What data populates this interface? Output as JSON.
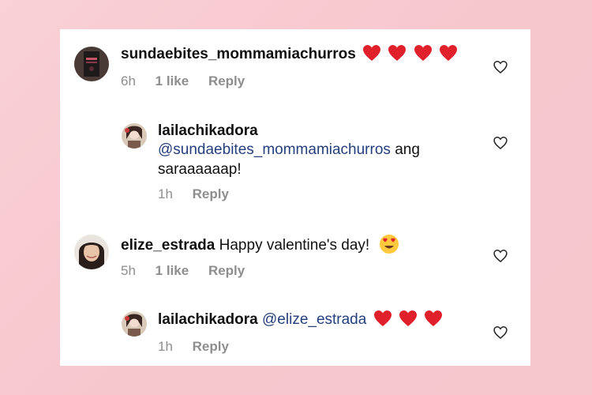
{
  "comments": [
    {
      "username": "sundaebites_mommamiachurros",
      "text": "",
      "emoji": [
        "heart-emoji",
        "heart-emoji",
        "heart-emoji",
        "heart-emoji"
      ],
      "time": "6h",
      "likes": "1 like",
      "reply": "Reply",
      "is_reply": false
    },
    {
      "username": "lailachikadora",
      "mention": "@sundaebites_mommamiachurros",
      "text_after_mention": " ang",
      "text_line2": "saraaaaaap!",
      "time": "1h",
      "reply": "Reply",
      "is_reply": true
    },
    {
      "username": "elize_estrada",
      "text": "Happy valentine's day!",
      "emoji": [
        "heart-eyes-emoji"
      ],
      "time": "5h",
      "likes": "1 like",
      "reply": "Reply",
      "is_reply": false
    },
    {
      "username": "lailachikadora",
      "mention": "@elize_estrada",
      "emoji": [
        "heart-emoji",
        "heart-emoji",
        "heart-emoji"
      ],
      "time": "1h",
      "reply": "Reply",
      "is_reply": true
    }
  ],
  "colors": {
    "background": "#f7c7ce",
    "card": "#ffffff",
    "mention": "#233f7c",
    "meta": "#8e8e8e",
    "heart": "#e0202a"
  }
}
